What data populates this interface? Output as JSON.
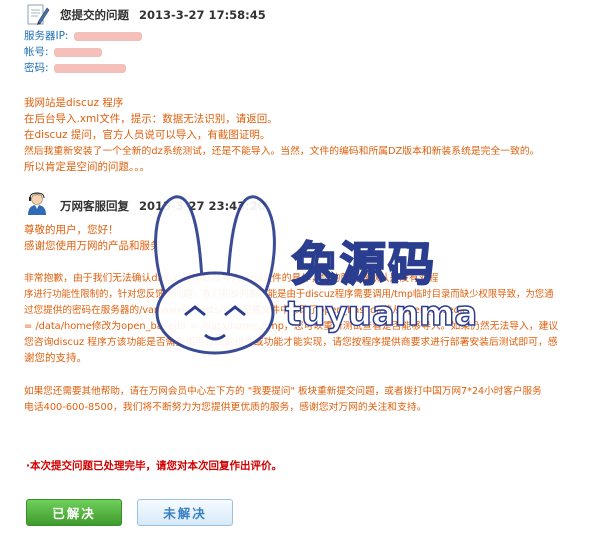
{
  "question": {
    "title": "您提交的问题",
    "datetime": "2013-3-27 17:58:45",
    "server_ip_label": "服务器IP:",
    "account_label": "帐号:",
    "password_label": "密码:",
    "body": [
      "我网站是discuz 程序",
      "在后台导入.xml文件，提示：数据无法识别，请返回。",
      "在discuz 提问，官方人员说可以导入，有截图证明。",
      "然后我重新安装了一个全新的dz系统测试，还是不能导入。当然，文件的编码和所属DZ版本和新装系统是完全一致的。",
      "所以肯定是空间的问题。。。"
    ]
  },
  "reply": {
    "title": "万网客服回复",
    "datetime": "2013-3-27 23:43:20",
    "greeting": [
      "尊敬的用户，您好！",
      "感谢您使用万网的产品和服务"
    ],
    "body": [
      "非常抱歉，由于我们无法确认discuz程序后台导入.xml文件的具体，您的服务器默认是没有对程",
      "序进行功能性限制的，针对您反馈的问题，我们初步判断可能是由于discuz程序需要调用/tmp临时目录而缺少权限导致，为您通",
      "过您提供的密码在服务器的/var/www/vhosts/*.ini配置文件中修改了open_basedir值从open_basedir",
      "= /data/home修改为open_basedir = /data/home:/tmp，您可以重新测试查看是否能够导入。如果仍然无法导入，建议",
      "您咨询discuz 程序方该功能是否需要调用特殊的组件或功能才能实现，请您按程序提供商要求进行部署安装后测试即可，感",
      "谢您的支持。"
    ],
    "closing": [
      "如果您还需要其他帮助，请在万网会员中心左下方的 \"我要提问\" 板块重新提交问题，或者拨打中国万网7*24小时客户服务",
      "电话400-600-8500，我们将不断努力为您提供更优质的服务，感谢您对万网的关注和支持。"
    ],
    "notice": "·本次提交问题已处理完毕，请您对本次回复作出评价。"
  },
  "buttons": {
    "solved": "已解决",
    "unsolved": "未解决"
  },
  "watermark": {
    "cn": "兔源码",
    "en": "tuyuanma"
  },
  "icons": {
    "question": "document-pencil-icon",
    "reply": "support-agent-icon"
  }
}
